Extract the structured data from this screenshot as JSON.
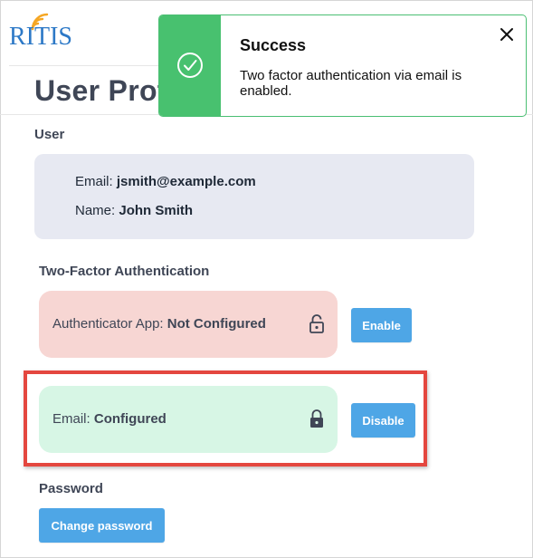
{
  "app": {
    "logo_text": "RITIS"
  },
  "page": {
    "title": "User Prof"
  },
  "user_section": {
    "label": "User",
    "email_label": "Email:",
    "email_value": "jsmith@example.com",
    "name_label": "Name:",
    "name_value": "John Smith"
  },
  "two_factor": {
    "label": "Two-Factor Authentication",
    "authenticator": {
      "label": "Authenticator App:",
      "status": "Not Configured",
      "lock_icon": "unlocked-padlock-icon",
      "button_label": "Enable",
      "color": "#f7d6d3"
    },
    "email": {
      "label": "Email:",
      "status": "Configured",
      "lock_icon": "locked-padlock-icon",
      "button_label": "Disable",
      "color": "#d7f6e5"
    }
  },
  "password_section": {
    "label": "Password",
    "button_label": "Change password"
  },
  "toast": {
    "title": "Success",
    "message": "Two factor authentication via email is enabled.",
    "accent_color": "#48c16f",
    "icon": "check-circle-icon",
    "close_icon": "close-icon"
  },
  "colors": {
    "button": "#4ea6e6",
    "highlight": "#e4473f",
    "brand": "#2d79c7"
  }
}
